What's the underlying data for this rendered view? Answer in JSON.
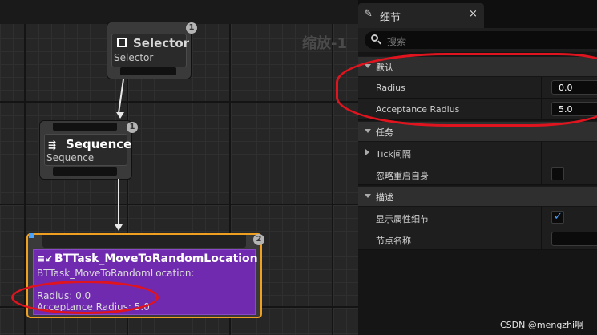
{
  "graph": {
    "zoom_label": "缩放-1",
    "selector": {
      "title": "Selector",
      "subtitle": "Selector",
      "badge": "1"
    },
    "sequence": {
      "title": "Sequence",
      "subtitle": "Sequence",
      "badge": "1"
    },
    "task": {
      "title": "BTTask_MoveToRandomLocation",
      "subtitle": "BTTask_MoveToRandomLocation:",
      "radius_line": "Radius: 0.0",
      "acceptance_line": "Acceptance Radius: 5.0",
      "badge": "2"
    }
  },
  "details": {
    "tab_label": "细节",
    "close_glyph": "×",
    "search_placeholder": "搜索",
    "categories": [
      {
        "label": "默认"
      },
      {
        "label": "任务"
      },
      {
        "label": "描述"
      }
    ],
    "default_rows": [
      {
        "name": "Radius",
        "value": "0.0"
      },
      {
        "name": "Acceptance Radius",
        "value": "5.0"
      }
    ],
    "task_rows": [
      {
        "name": "Tick间隔"
      },
      {
        "name": "忽略重启自身",
        "checked": false
      }
    ],
    "desc_rows": [
      {
        "name": "显示属性细节",
        "checked": true
      },
      {
        "name": "节点名称",
        "value": ""
      }
    ]
  },
  "watermark": "CSDN @mengzhi啊",
  "colors": {
    "task_body": "#6f2ab0",
    "task_border": "#f0a020",
    "annotation": "#e0141e",
    "checkmark": "#4aa3ff"
  }
}
